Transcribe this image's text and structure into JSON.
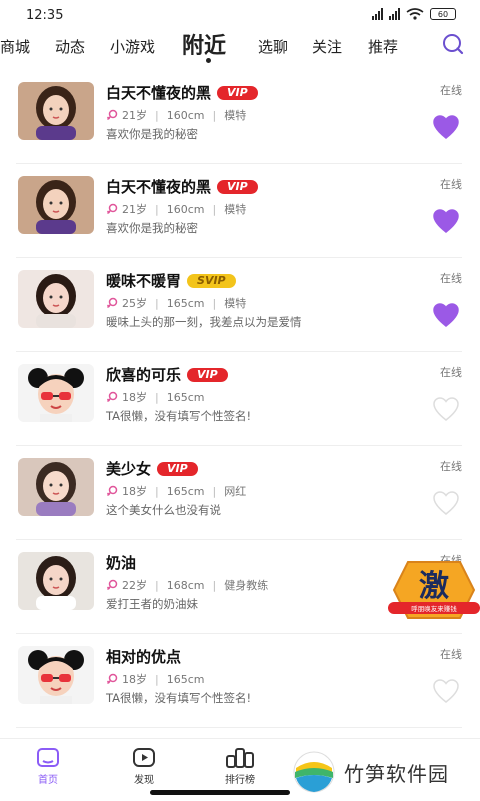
{
  "status_bar": {
    "time": "12:35",
    "battery": "60"
  },
  "nav": {
    "tabs": [
      {
        "label": "商城"
      },
      {
        "label": "动态"
      },
      {
        "label": "小游戏"
      },
      {
        "label": "附近"
      },
      {
        "label": "选聊"
      },
      {
        "label": "关注"
      },
      {
        "label": "推荐"
      }
    ],
    "active_tab": "附近"
  },
  "users": [
    {
      "name": "白天不懂夜的黑",
      "badge": "VIP",
      "age": "21岁",
      "height": "160cm",
      "job": "模特",
      "signature": "喜欢你是我的秘密",
      "status": "在线",
      "liked": true
    },
    {
      "name": "白天不懂夜的黑",
      "badge": "VIP",
      "age": "21岁",
      "height": "160cm",
      "job": "模特",
      "signature": "喜欢你是我的秘密",
      "status": "在线",
      "liked": true
    },
    {
      "name": "暖味不暖胃",
      "badge": "SVIP",
      "age": "25岁",
      "height": "165cm",
      "job": "模特",
      "signature": "暖味上头的那一刻，我差点以为是爱情",
      "status": "在线",
      "liked": true
    },
    {
      "name": "欣喜的可乐",
      "badge": "VIP",
      "age": "18岁",
      "height": "165cm",
      "job": "",
      "signature": "TA很懒，没有填写个性签名!",
      "status": "在线",
      "liked": false
    },
    {
      "name": "美少女",
      "badge": "VIP",
      "age": "18岁",
      "height": "165cm",
      "job": "网红",
      "signature": "这个美女什么也没有说",
      "status": "在线",
      "liked": false
    },
    {
      "name": "奶油",
      "badge": "",
      "age": "22岁",
      "height": "168cm",
      "job": "健身教练",
      "signature": "爱打王者的奶油妹",
      "status": "在线",
      "liked": false
    },
    {
      "name": "相对的优点",
      "badge": "",
      "age": "18岁",
      "height": "165cm",
      "job": "",
      "signature": "TA很懒，没有填写个性签名!",
      "status": "在线",
      "liked": false
    }
  ],
  "promo_badge": {
    "char": "激",
    "caption": "呼朋唤友来赚钱"
  },
  "bottom_nav": [
    {
      "label": "首页",
      "icon": "home-icon",
      "active": true
    },
    {
      "label": "发现",
      "icon": "play-icon",
      "active": false
    },
    {
      "label": "排行榜",
      "icon": "ranking-icon",
      "active": false
    }
  ],
  "watermark": {
    "text": "竹笋软件园"
  },
  "colors": {
    "accent": "#8b5cf6",
    "vip": "#e4262b",
    "svip": "#f3c41b",
    "heart_liked": "#9b59e6",
    "heart_empty": "#dddddd",
    "gender": "#e0559a"
  }
}
